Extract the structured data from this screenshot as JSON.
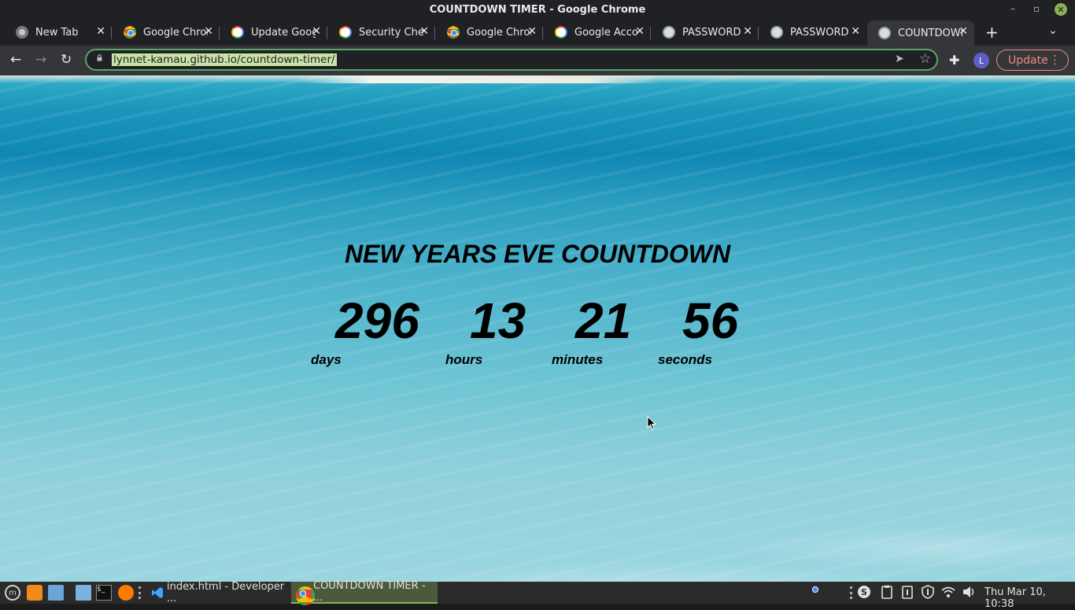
{
  "window": {
    "title": "COUNTDOWN TIMER - Google Chrome",
    "min_glyph": "–",
    "max_glyph": "▫",
    "close_glyph": "✕"
  },
  "tabs": [
    {
      "label": "New Tab",
      "icon": "chrome-newtab-icon",
      "active": false
    },
    {
      "label": "Google Chrome",
      "icon": "chrome-icon",
      "active": false
    },
    {
      "label": "Update Google",
      "icon": "google-icon",
      "active": false
    },
    {
      "label": "Security Check",
      "icon": "google-icon",
      "active": false
    },
    {
      "label": "Google Chrome",
      "icon": "chrome-icon",
      "active": false
    },
    {
      "label": "Google Account",
      "icon": "google-icon",
      "active": false
    },
    {
      "label": "PASSWORD",
      "icon": "globe-icon",
      "active": false
    },
    {
      "label": "PASSWORD",
      "icon": "globe-icon",
      "active": false
    },
    {
      "label": "COUNTDOWN",
      "icon": "globe-icon",
      "active": true
    }
  ],
  "tab_close_glyph": "✕",
  "new_tab_glyph": "+",
  "tab_search_glyph": "⌄",
  "toolbar": {
    "back_glyph": "←",
    "forward_glyph": "→",
    "reload_glyph": "↻",
    "url": "lynnet-kamau.github.io/countdown-timer/",
    "send_glyph": "➤",
    "star_glyph": "☆",
    "extensions_glyph": "✚",
    "avatar_letter": "L",
    "update_label": "Update",
    "menu_glyph": "⋮"
  },
  "page": {
    "heading": "NEW YEARS EVE COUNTDOWN",
    "countdown": {
      "days": "296",
      "hours": "13",
      "minutes": "21",
      "seconds": "56"
    },
    "units": {
      "days": "days",
      "hours": "hours",
      "minutes": "minutes",
      "seconds": "seconds"
    }
  },
  "taskbar": {
    "tasks": [
      {
        "label": "index.html - Developer ..."
      },
      {
        "label": "COUNTDOWN TIMER - ..."
      }
    ],
    "clock": "Thu Mar 10, 10:38",
    "terminal_glyph": "$_",
    "menu_glyph": "m"
  },
  "colors": {
    "accent": "#8bb158",
    "omnibox_border": "#5aa469",
    "update_button": "#f28b82",
    "url_highlight": "#c9e3a7"
  }
}
